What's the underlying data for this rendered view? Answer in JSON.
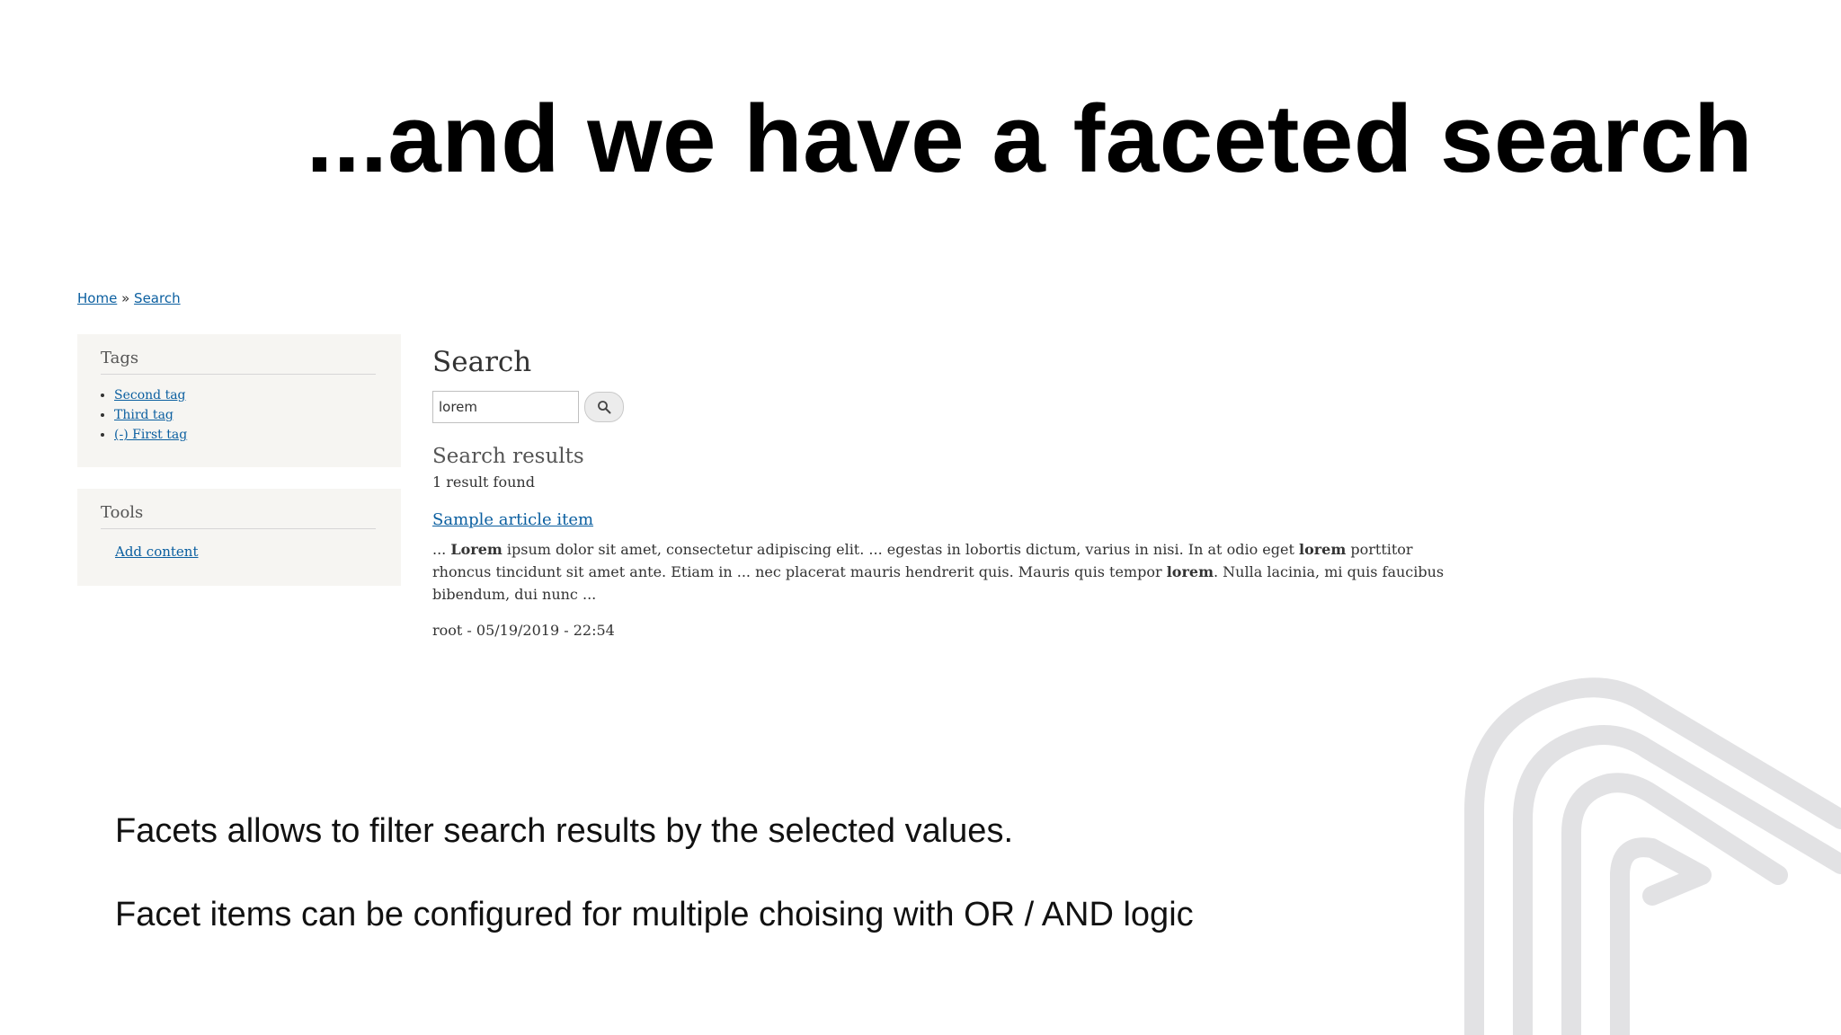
{
  "slide": {
    "title": "...and we have a faceted search",
    "notes": [
      "Facets allows to filter search results by the selected values.",
      "Facet items can be configured for multiple choising with OR / AND logic"
    ],
    "watermark_icon": "brand-logo-outline",
    "watermark_color": "#e2e2e4"
  },
  "breadcrumb": {
    "home": "Home",
    "separator": "»",
    "current": "Search"
  },
  "sidebar": {
    "tags_block": {
      "title": "Tags",
      "items": [
        {
          "label": "Second tag"
        },
        {
          "label": "Third tag"
        },
        {
          "label": "(-) First tag"
        }
      ]
    },
    "tools_block": {
      "title": "Tools",
      "link": "Add content"
    }
  },
  "search": {
    "heading": "Search",
    "input_value": "lorem",
    "button_icon": "search-icon",
    "results_heading": "Search results",
    "results_count": "1 result found",
    "result": {
      "title": "Sample article item",
      "snippet_parts": [
        "... ",
        "Lorem",
        " ipsum dolor sit amet, consectetur adipiscing elit. ... egestas in lobortis dictum, varius in nisi. In at odio eget ",
        "lorem",
        " porttitor rhoncus tincidunt sit amet ante. Etiam in ... nec placerat mauris hendrerit quis. Mauris quis tempor ",
        "lorem",
        ". Nulla lacinia, mi quis faucibus bibendum, dui nunc ..."
      ],
      "meta": "root - 05/19/2019 - 22:54"
    }
  },
  "colors": {
    "link": "#0b5fa0",
    "block_bg": "#f6f5f2"
  }
}
